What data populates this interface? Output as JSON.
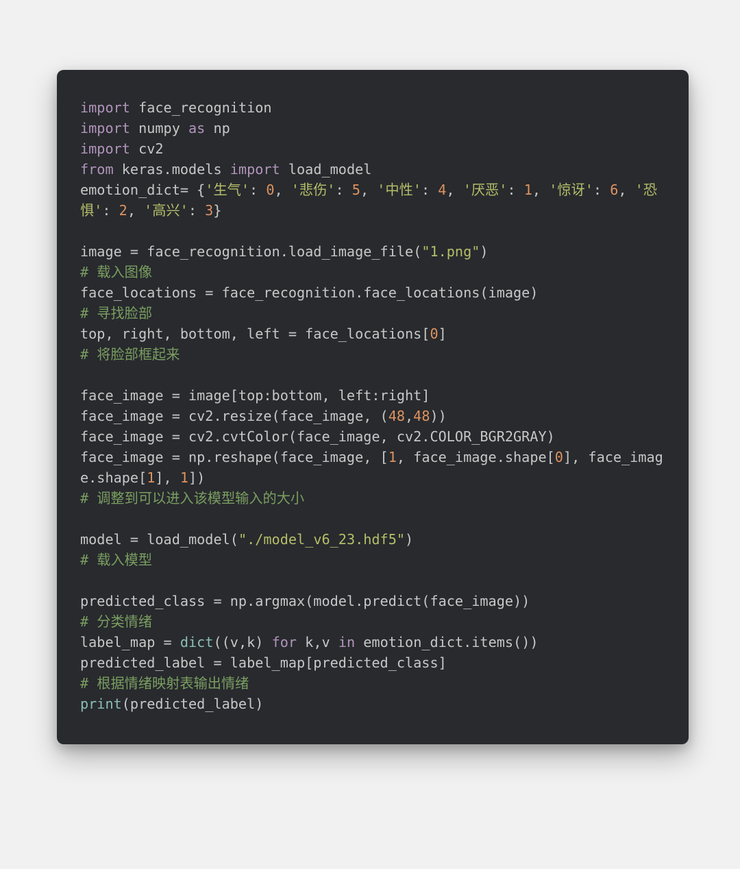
{
  "code": {
    "tokens": [
      {
        "t": "import",
        "c": "kw"
      },
      {
        "t": " face_recognition\n"
      },
      {
        "t": "import",
        "c": "kw"
      },
      {
        "t": " numpy "
      },
      {
        "t": "as",
        "c": "kw"
      },
      {
        "t": " np\n"
      },
      {
        "t": "import",
        "c": "kw"
      },
      {
        "t": " cv2\n"
      },
      {
        "t": "from",
        "c": "kw"
      },
      {
        "t": " keras.models "
      },
      {
        "t": "import",
        "c": "kw"
      },
      {
        "t": " load_model\n"
      },
      {
        "t": "emotion_dict= {"
      },
      {
        "t": "'生气'",
        "c": "str"
      },
      {
        "t": ": "
      },
      {
        "t": "0",
        "c": "num"
      },
      {
        "t": ", "
      },
      {
        "t": "'悲伤'",
        "c": "str"
      },
      {
        "t": ": "
      },
      {
        "t": "5",
        "c": "num"
      },
      {
        "t": ", "
      },
      {
        "t": "'中性'",
        "c": "str"
      },
      {
        "t": ": "
      },
      {
        "t": "4",
        "c": "num"
      },
      {
        "t": ", "
      },
      {
        "t": "'厌恶'",
        "c": "str"
      },
      {
        "t": ": "
      },
      {
        "t": "1",
        "c": "num"
      },
      {
        "t": ", "
      },
      {
        "t": "'惊讶'",
        "c": "str"
      },
      {
        "t": ": "
      },
      {
        "t": "6",
        "c": "num"
      },
      {
        "t": ", "
      },
      {
        "t": "'恐惧'",
        "c": "str"
      },
      {
        "t": ": "
      },
      {
        "t": "2",
        "c": "num"
      },
      {
        "t": ", "
      },
      {
        "t": "'高兴'",
        "c": "str"
      },
      {
        "t": ": "
      },
      {
        "t": "3",
        "c": "num"
      },
      {
        "t": "}\n"
      },
      {
        "t": "\n"
      },
      {
        "t": "image = face_recognition.load_image_file("
      },
      {
        "t": "\"1.png\"",
        "c": "str"
      },
      {
        "t": ")\n"
      },
      {
        "t": "# 载入图像\n",
        "c": "com"
      },
      {
        "t": "face_locations = face_recognition.face_locations(image)\n"
      },
      {
        "t": "# 寻找脸部\n",
        "c": "com"
      },
      {
        "t": "top, right, bottom, left = face_locations["
      },
      {
        "t": "0",
        "c": "num"
      },
      {
        "t": "]\n"
      },
      {
        "t": "# 将脸部框起来\n",
        "c": "com"
      },
      {
        "t": "\n"
      },
      {
        "t": "face_image = image[top:bottom, left:right]\n"
      },
      {
        "t": "face_image = cv2.resize(face_image, ("
      },
      {
        "t": "48",
        "c": "num"
      },
      {
        "t": ","
      },
      {
        "t": "48",
        "c": "num"
      },
      {
        "t": "))\n"
      },
      {
        "t": "face_image = cv2.cvtColor(face_image, cv2.COLOR_BGR2GRAY)\n"
      },
      {
        "t": "face_image = np.reshape(face_image, ["
      },
      {
        "t": "1",
        "c": "num"
      },
      {
        "t": ", face_image.shape["
      },
      {
        "t": "0",
        "c": "num"
      },
      {
        "t": "], face_image.shape["
      },
      {
        "t": "1",
        "c": "num"
      },
      {
        "t": "], "
      },
      {
        "t": "1",
        "c": "num"
      },
      {
        "t": "])\n"
      },
      {
        "t": "# 调整到可以进入该模型输入的大小\n",
        "c": "com"
      },
      {
        "t": "\n"
      },
      {
        "t": "model = load_model("
      },
      {
        "t": "\"./model_v6_23.hdf5\"",
        "c": "str"
      },
      {
        "t": ")\n"
      },
      {
        "t": "# 载入模型\n",
        "c": "com"
      },
      {
        "t": "\n"
      },
      {
        "t": "predicted_class = np.argmax(model.predict(face_image))\n"
      },
      {
        "t": "# 分类情绪\n",
        "c": "com"
      },
      {
        "t": "label_map = "
      },
      {
        "t": "dict",
        "c": "fn"
      },
      {
        "t": "((v,k) "
      },
      {
        "t": "for",
        "c": "kw"
      },
      {
        "t": " k,v "
      },
      {
        "t": "in",
        "c": "kw"
      },
      {
        "t": " emotion_dict.items())\n"
      },
      {
        "t": "predicted_label = label_map[predicted_class]\n"
      },
      {
        "t": "# 根据情绪映射表输出情绪\n",
        "c": "com"
      },
      {
        "t": "print",
        "c": "fn"
      },
      {
        "t": "(predicted_label)\n"
      }
    ]
  }
}
